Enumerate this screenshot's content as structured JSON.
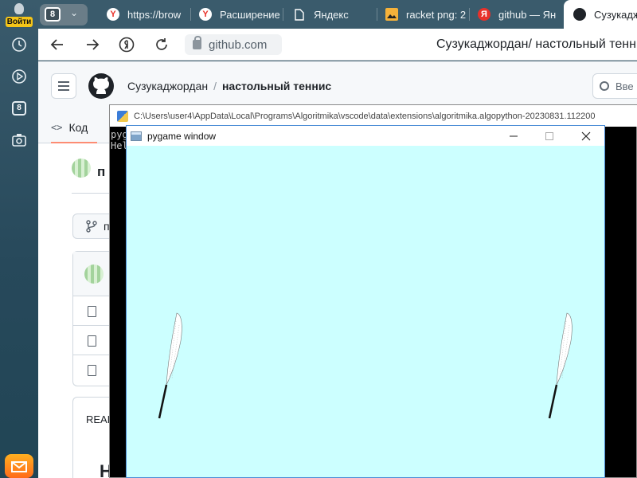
{
  "rail": {
    "login_label": "Войти",
    "tab_badge": "8"
  },
  "tabs": {
    "count": "8",
    "items": [
      {
        "label": "https://brow",
        "favicon": "yandex-icon"
      },
      {
        "label": "Расширение",
        "favicon": "yandex-icon"
      },
      {
        "label": "Яндекс",
        "favicon": "document-icon"
      },
      {
        "label": "racket png: 2",
        "favicon": "image-icon"
      },
      {
        "label": "github — Ян",
        "favicon": "yandex-icon"
      },
      {
        "label": "Сузукаджо",
        "favicon": "github-icon"
      }
    ]
  },
  "address": {
    "url": "github.com",
    "page_title": "Сузукаджордан/ настольный тенни"
  },
  "github": {
    "owner": "Сузукаджордан",
    "repo": "настольный теннис",
    "search_placeholder": "Вве",
    "code_tab": "Код",
    "repo_title_fragment": "п",
    "branch_fragment": "п",
    "readme_label": "READ",
    "readme_heading": "Н"
  },
  "console": {
    "title": "C:\\Users\\user4\\AppData\\Local\\Programs\\Algoritmika\\vscode\\data\\extensions\\algoritmika.algopython-20230831.112200",
    "output_lines": [
      "pyg",
      "Hel"
    ]
  },
  "pygame": {
    "title": "pygame window",
    "background": "#ccffff"
  },
  "colors": {
    "rail_bg": "#2c4e5f",
    "tab_bar": "#3a5b6c",
    "accent_underline": "#fd8c73",
    "yandex_red": "#e8312a"
  }
}
